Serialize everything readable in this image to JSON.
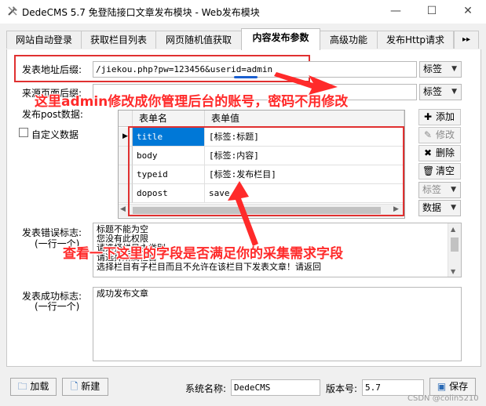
{
  "window": {
    "title": "DedeCMS 5.7 免登陆接口文章发布模块 - Web发布模块",
    "minimize": "—",
    "maximize": "☐",
    "close": "✕"
  },
  "tabs": [
    {
      "label": "网站自动登录"
    },
    {
      "label": "获取栏目列表"
    },
    {
      "label": "网页随机值获取"
    },
    {
      "label": "内容发布参数",
      "active": true
    },
    {
      "label": "高级功能"
    },
    {
      "label": "发布Http请求"
    },
    {
      "label": "▸▸"
    }
  ],
  "form": {
    "url_suffix_label": "发表地址后缀:",
    "url_suffix_value": "/jiekou.php?pw=123456&userid=admin",
    "tag_label": "标签",
    "referer_label": "来源页面后缀:",
    "post_data_label": "发布post数据:",
    "custom_data_label": "自定义数据",
    "error_label": "发表错误标志:",
    "error_sublabel": "(一行一个)",
    "success_label": "发表成功标志:",
    "success_sublabel": "(一行一个)"
  },
  "grid": {
    "columns": [
      "表单名",
      "表单值"
    ],
    "rows": [
      {
        "name": "title",
        "value": "[标签:标题]",
        "selected": true
      },
      {
        "name": "body",
        "value": "[标签:内容]"
      },
      {
        "name": "typeid",
        "value": "[标签:发布栏目]"
      },
      {
        "name": "dopost",
        "value": "save"
      }
    ]
  },
  "side_buttons": {
    "add": "添加",
    "edit": "修改",
    "delete": "删除",
    "clear": "清空",
    "tag": "标签",
    "data": "数据"
  },
  "error_lines": [
    "标题不能为空",
    "您没有此权限",
    "请选择栏目主类别",
    "请选择所属栏目",
    "选择栏目有子栏目而且不允许在该栏目下发表文章！请返回"
  ],
  "success_lines": [
    "成功发布文章"
  ],
  "bottom": {
    "load": "加载",
    "new": "新建",
    "system_name_label": "系统名称:",
    "system_name_value": "DedeCMS",
    "version_label": "版本号:",
    "version_value": "5.7",
    "save": "保存"
  },
  "annotations": {
    "top": "这里admin修改成你管理后台的账号，密码不用修改",
    "middle": "查看一下这里的字段是否满足你的采集需求字段"
  },
  "watermark": "CSDN @colin5210",
  "colors": {
    "annotation": "#ff2a2a",
    "selection": "#0078d7",
    "underline": "#1a5fd0"
  }
}
